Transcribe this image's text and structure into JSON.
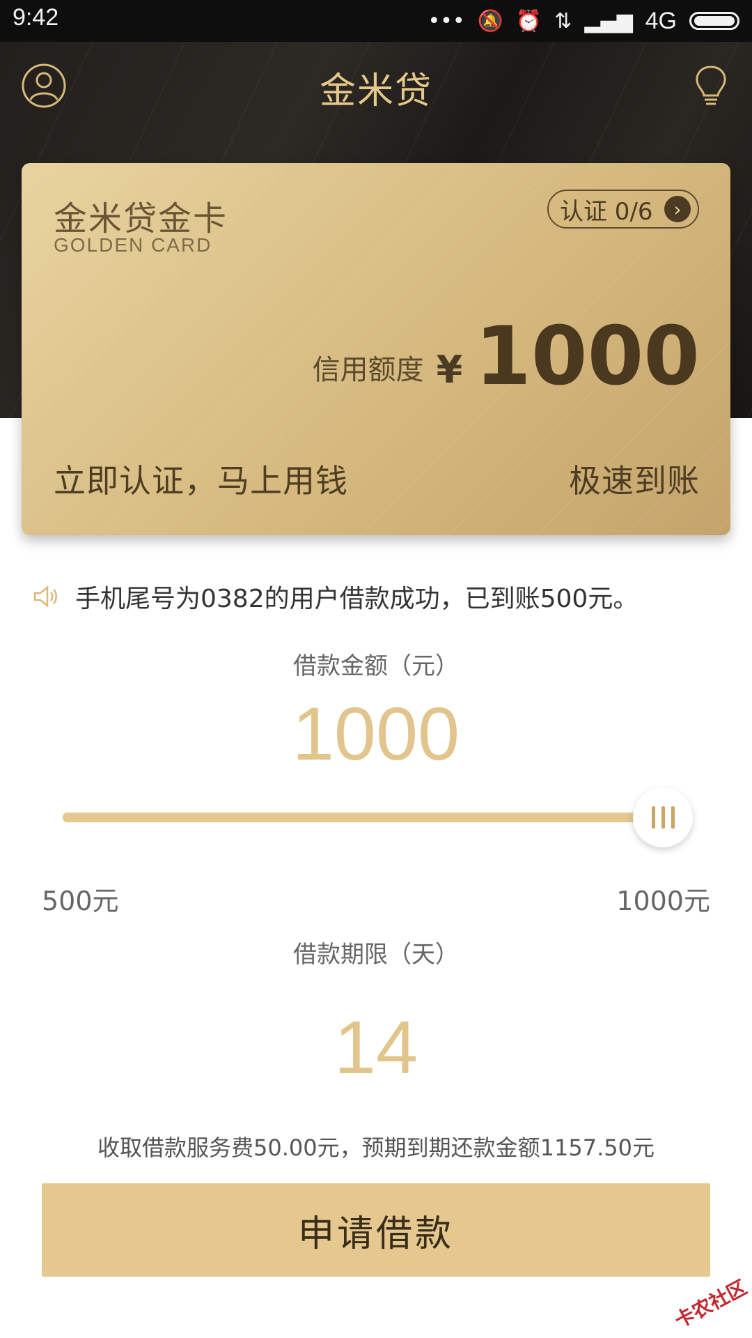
{
  "status_bar": {
    "time": "9:42",
    "network": "4G"
  },
  "header": {
    "title": "金米贷"
  },
  "card": {
    "title": "金米贷金卡",
    "subtitle": "GOLDEN CARD",
    "verify_label": "认证 0/6",
    "credit_label": "信用额度",
    "currency": "¥",
    "credit_amount": "1000",
    "slogan_left": "立即认证，马上用钱",
    "slogan_right": "极速到账"
  },
  "notice": {
    "text": "手机尾号为0382的用户借款成功，已到账500元。"
  },
  "loan_amount": {
    "label": "借款金额（元）",
    "value": "1000",
    "min_label": "500元",
    "max_label": "1000元",
    "slider_fraction": 1.0
  },
  "loan_term": {
    "label": "借款期限（天）",
    "value": "14"
  },
  "fee_text": "收取借款服务费50.00元，预期到期还款金额1157.50元",
  "apply_button": "申请借款",
  "watermark": "卡农社区",
  "colors": {
    "gold": "#e4c88f",
    "dark_header": "#221f1c",
    "accent_text": "#e6c98a"
  },
  "icons": [
    "user-icon",
    "lightbulb-icon",
    "chevron-right-icon",
    "speaker-icon"
  ]
}
